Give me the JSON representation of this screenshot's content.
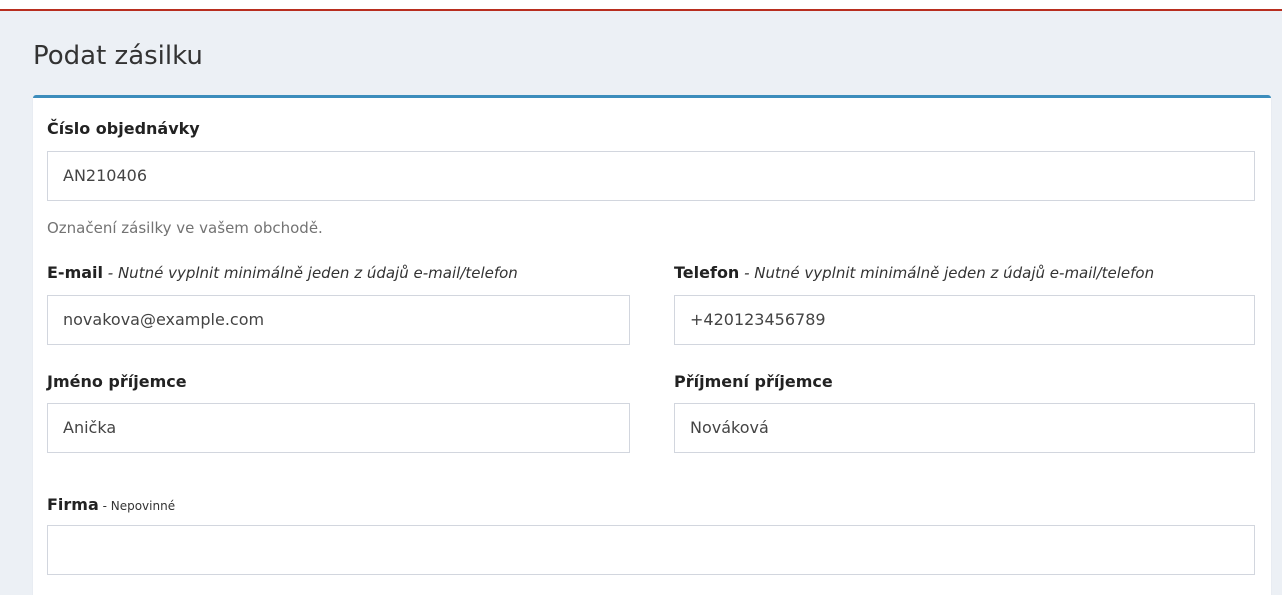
{
  "page": {
    "title": "Podat zásilku"
  },
  "form": {
    "order_number": {
      "label": "Číslo objednávky",
      "value": "AN210406",
      "help": "Označení zásilky ve vašem obchodě."
    },
    "email": {
      "label": "E-mail",
      "hint": " - Nutné vyplnit minimálně jeden z údajů e-mail/telefon",
      "value": "novakova@example.com"
    },
    "phone": {
      "label": "Telefon",
      "hint": " - Nutné vyplnit minimálně jeden z údajů e-mail/telefon",
      "value": "+420123456789"
    },
    "first_name": {
      "label": "Jméno příjemce",
      "value": "Anička"
    },
    "last_name": {
      "label": "Příjmení příjemce",
      "value": "Nováková"
    },
    "company": {
      "label": "Firma",
      "hint": " - Nepovinné",
      "value": ""
    }
  },
  "colors": {
    "accent": "#3c8dbc",
    "top_line": "#b82e1f",
    "page_background": "#ecf0f5"
  }
}
